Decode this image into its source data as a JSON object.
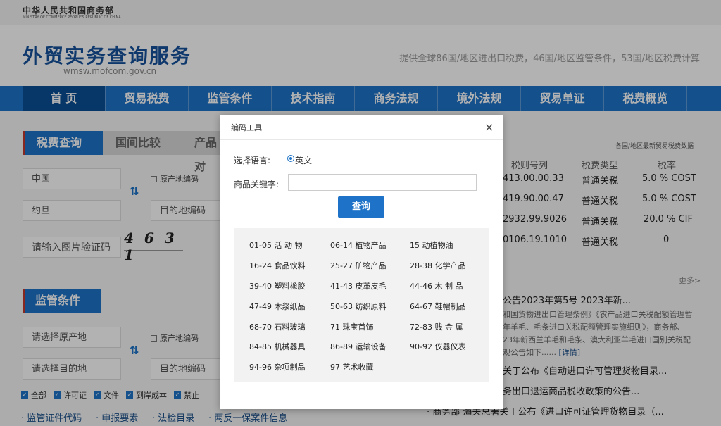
{
  "ministry": {
    "name_cn": "中华人民共和国商务部",
    "name_en": "MINISTRY OF COMMERCE PEOPLE'S REPUBLIC OF CHINA"
  },
  "site": {
    "title": "外贸实务查询服务",
    "url": "wmsw.mofcom.gov.cn",
    "tagline": "提供全球86国/地区进出口税费，46国/地区监管条件，53国/地区税费计算"
  },
  "nav": [
    "首 页",
    "贸易税费",
    "监管条件",
    "技术指南",
    "商务法规",
    "境外法规",
    "贸易单证",
    "税费概览"
  ],
  "fee_panel": {
    "tabs": [
      "税费查询",
      "国间比较",
      "产品对"
    ],
    "origin": "中国",
    "destination": "约旦",
    "origin_code_label": "原产地编码",
    "dest_code_placeholder": "目的地编码",
    "captcha_placeholder": "请输入图片验证码",
    "captcha_text": "4 6 3 1"
  },
  "regulation_panel": {
    "title": "监管条件",
    "origin_placeholder": "请选择原产地",
    "origin_code_label": "原产地编码",
    "dest_placeholder": "请选择目的地",
    "dest_code_placeholder": "目的地编码",
    "filters": [
      "全部",
      "许可证",
      "文件",
      "到岸成本",
      "禁止"
    ],
    "links": [
      "· 监管证件代码",
      "· 申报要素",
      "· 法检目录",
      "· 两反一保案件信息"
    ]
  },
  "tariff_table": {
    "hint": "各国/地区最新贸易税费数据",
    "headers": [
      "税则号列",
      "税费类型",
      "税率"
    ],
    "rows": [
      {
        "code": "413.00.00.33",
        "type": "普通关税",
        "rate": "5.0 % COST"
      },
      {
        "code": "419.90.00.47",
        "type": "普通关税",
        "rate": "5.0 % COST"
      },
      {
        "code": "2932.99.9026",
        "type": "普通关税",
        "rate": "20.0 % CIF"
      },
      {
        "code": "0106.19.1010",
        "type": "普通关税",
        "rate": "0"
      }
    ],
    "more": "更多>"
  },
  "news": {
    "headline": "公告2023年第5号 2023年新...",
    "desc_lines": [
      "和国货物进出口管理条例》《农产品进口关税配额管理暂",
      "年羊毛、毛条进口关税配额管理实施细则》，商务部、",
      "23年新西兰羊毛和毛条、澳大利亚羊毛进口国别关税配",
      "观公告如下......"
    ],
    "detail_link": "[详情]",
    "items": [
      "关于公布《自动进口许可管理货物目录...",
      "务出口退运商品税收政策的公告...",
      "· 商务部 海关总署关于公布《进口许可证管理货物目录（..."
    ]
  },
  "modal": {
    "title": "编码工具",
    "close": "×",
    "lang_label": "选择语言:",
    "lang_option": "英文",
    "keyword_label": "商品关键字:",
    "keyword_value": "",
    "query_button": "查询",
    "codes": [
      [
        "01-05 活  动  物",
        "06-14 植物产品",
        "15      动植物油"
      ],
      [
        "16-24 食品饮料",
        "25-27 矿物产品",
        "28-38 化学产品"
      ],
      [
        "39-40 塑料橡胶",
        "41-43 皮革皮毛",
        "44-46 木  制  品"
      ],
      [
        "47-49 木浆纸品",
        "50-63 纺织原料",
        "64-67 鞋帽制品"
      ],
      [
        "68-70 石料玻璃",
        "71        珠宝首饰",
        "72-83 贱  金  属"
      ],
      [
        "84-85 机械器具",
        "86-89 运输设备",
        "90-92 仪器仪表"
      ],
      [
        "94-96 杂项制品",
        "97        艺术收藏",
        ""
      ]
    ]
  }
}
